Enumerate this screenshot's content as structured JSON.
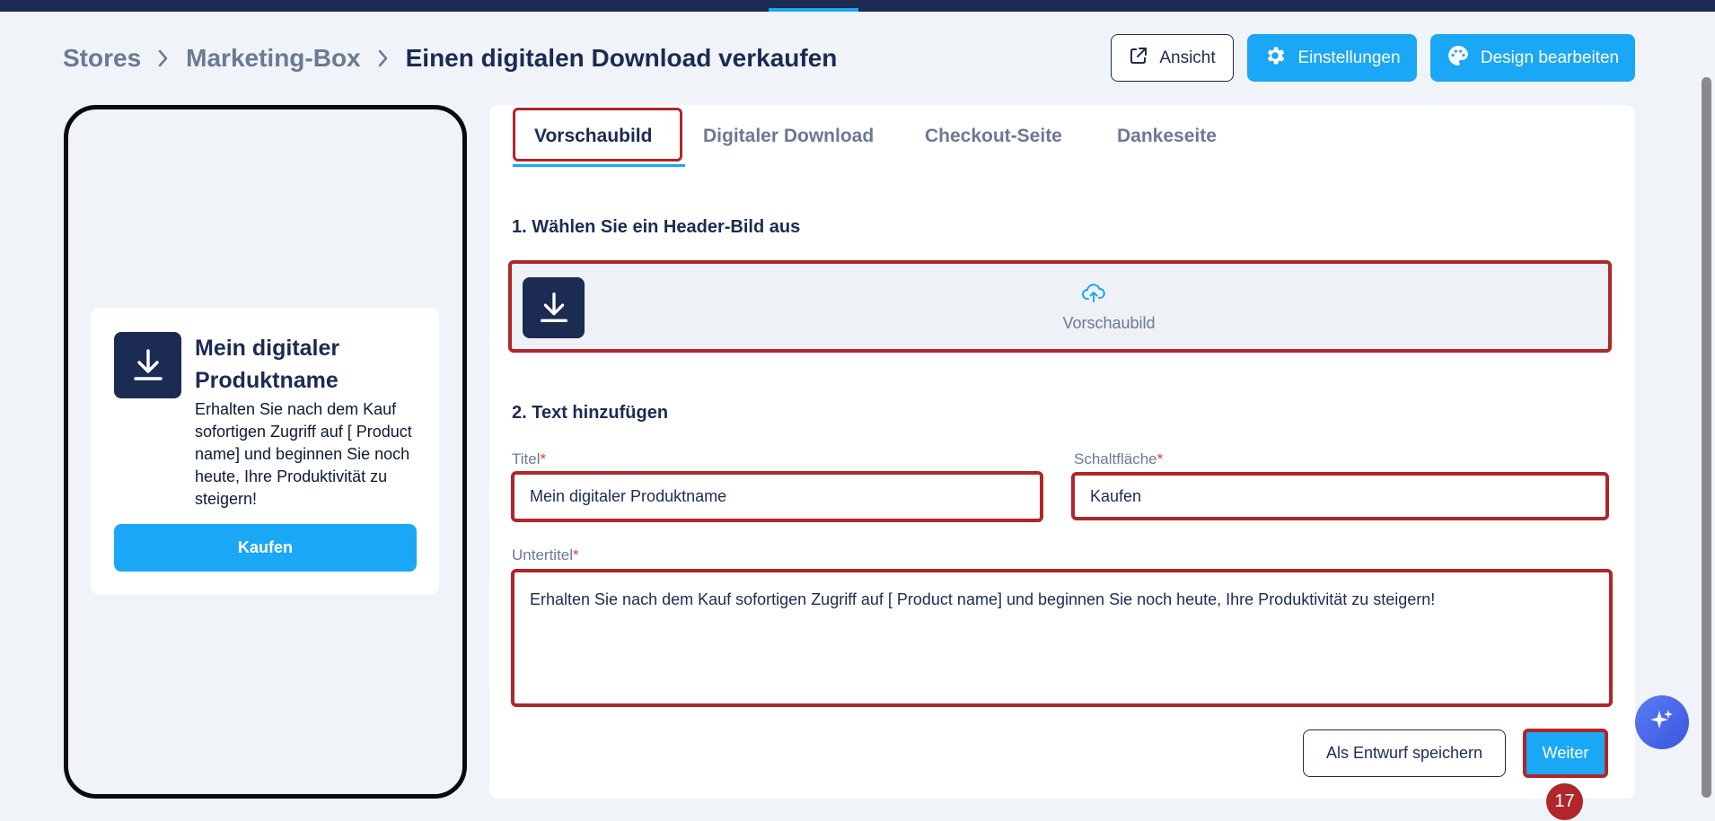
{
  "breadcrumb": {
    "items": [
      "Stores",
      "Marketing-Box"
    ],
    "current": "Einen digitalen Download verkaufen"
  },
  "header_buttons": {
    "view": "Ansicht",
    "settings": "Einstellungen",
    "design": "Design bearbeiten"
  },
  "preview": {
    "title": "Mein digitaler Produktname",
    "text": "Erhalten Sie nach dem Kauf sofortigen Zugriff auf [ Product name] und beginnen Sie noch heute, Ihre Produktivität zu steigern!",
    "button": "Kaufen"
  },
  "tabs": [
    {
      "label": "Vorschaubild",
      "active": true
    },
    {
      "label": "Digitaler Download",
      "active": false
    },
    {
      "label": "Checkout-Seite",
      "active": false
    },
    {
      "label": "Dankeseite",
      "active": false
    }
  ],
  "section1": {
    "heading": "1. Wählen Sie ein Header-Bild aus",
    "upload_label": "Vorschaubild"
  },
  "section2": {
    "heading": "2. Text hinzufügen",
    "title_label": "Titel",
    "title_value": "Mein digitaler Produktname",
    "button_label": "Schaltfläche",
    "button_value": "Kaufen",
    "subtitle_label": "Untertitel",
    "subtitle_value": "Erhalten Sie nach dem Kauf sofortigen Zugriff auf [ Product name] und beginnen Sie noch heute, Ihre Produktivität zu steigern!",
    "required_mark": "*"
  },
  "footer": {
    "draft": "Als Entwurf speichern",
    "next": "Weiter"
  },
  "step_badge": "17",
  "colors": {
    "primary": "#1aa7f5",
    "navy": "#1b2b52",
    "highlight": "#b0262a",
    "muted": "#6b7a93"
  }
}
